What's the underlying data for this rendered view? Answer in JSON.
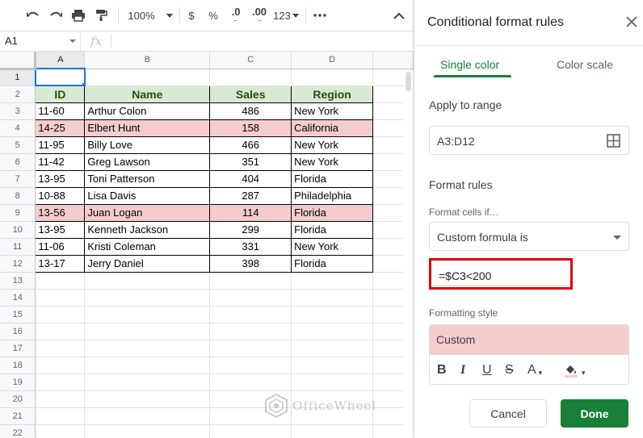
{
  "toolbar": {
    "zoom": "100%",
    "currency": "$",
    "percent": "%",
    "decrease_decimal": ".0",
    "increase_decimal": ".00",
    "more_formats": "123"
  },
  "formula_bar": {
    "name_box": "A1",
    "fx": "fx"
  },
  "sheet": {
    "columns": [
      "A",
      "B",
      "C",
      "D"
    ],
    "rows": [
      {
        "n": "1",
        "cells": [
          "",
          "",
          "",
          ""
        ]
      },
      {
        "n": "2",
        "cells": [
          "ID",
          "Name",
          "Sales",
          "Region"
        ]
      },
      {
        "n": "3",
        "cells": [
          "11-60",
          "Arthur Colon",
          "486",
          "New York"
        ]
      },
      {
        "n": "4",
        "cells": [
          "14-25",
          "Elbert Hunt",
          "158",
          "California"
        ]
      },
      {
        "n": "5",
        "cells": [
          "11-95",
          "Billy Love",
          "466",
          "New York"
        ]
      },
      {
        "n": "6",
        "cells": [
          "11-42",
          "Greg Lawson",
          "351",
          "New York"
        ]
      },
      {
        "n": "7",
        "cells": [
          "13-95",
          "Toni Patterson",
          "404",
          "Florida"
        ]
      },
      {
        "n": "8",
        "cells": [
          "10-88",
          "Lisa Davis",
          "287",
          "Philadelphia"
        ]
      },
      {
        "n": "9",
        "cells": [
          "13-56",
          "Juan Logan",
          "114",
          "Florida"
        ]
      },
      {
        "n": "10",
        "cells": [
          "13-95",
          "Kenneth Jackson",
          "299",
          "Florida"
        ]
      },
      {
        "n": "11",
        "cells": [
          "11-06",
          "Kristi Coleman",
          "331",
          "New York"
        ]
      },
      {
        "n": "12",
        "cells": [
          "13-17",
          "Jerry Daniel",
          "398",
          "Florida"
        ]
      },
      {
        "n": "13",
        "cells": [
          "",
          "",
          "",
          ""
        ]
      },
      {
        "n": "14",
        "cells": [
          "",
          "",
          "",
          ""
        ]
      },
      {
        "n": "15",
        "cells": [
          "",
          "",
          "",
          ""
        ]
      },
      {
        "n": "16",
        "cells": [
          "",
          "",
          "",
          ""
        ]
      },
      {
        "n": "17",
        "cells": [
          "",
          "",
          "",
          ""
        ]
      },
      {
        "n": "18",
        "cells": [
          "",
          "",
          "",
          ""
        ]
      },
      {
        "n": "19",
        "cells": [
          "",
          "",
          "",
          ""
        ]
      },
      {
        "n": "20",
        "cells": [
          "",
          "",
          "",
          ""
        ]
      },
      {
        "n": "21",
        "cells": [
          "",
          "",
          "",
          ""
        ]
      },
      {
        "n": "22",
        "cells": [
          "",
          "",
          "",
          ""
        ]
      }
    ],
    "header_fill": "#d9ead3",
    "highlight_fill": "#f4cccc"
  },
  "panel": {
    "title": "Conditional format rules",
    "tabs": {
      "single": "Single color",
      "scale": "Color scale"
    },
    "apply_label": "Apply to range",
    "range": "A3:D12",
    "format_rules_label": "Format rules",
    "format_cells_if_label": "Format cells if…",
    "condition": "Custom formula is",
    "formula": "=$C3<200",
    "formatting_style_label": "Formatting style",
    "style_preview": "Custom",
    "style_buttons": {
      "bold": "B",
      "italic": "I",
      "underline": "U",
      "strike": "S",
      "text_color": "A"
    },
    "cancel": "Cancel",
    "done": "Done",
    "accent": "#188038",
    "highlight_border": "#e00000"
  },
  "watermark": "OfficeWheel"
}
